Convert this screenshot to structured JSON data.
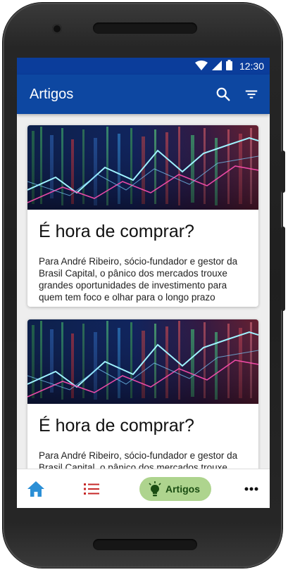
{
  "status_bar": {
    "time": "12:30"
  },
  "app_bar": {
    "title": "Artigos"
  },
  "articles": [
    {
      "title": "É hora de comprar?",
      "summary": "Para André Ribeiro, sócio-fundador e gestor da Brasil Capital, o pânico dos mercados trouxe grandes oportunidades de investimento para quem tem foco e olhar para o longo prazo"
    },
    {
      "title": "É hora de comprar?",
      "summary": "Para André Ribeiro, sócio-fundador e gestor da Brasil Capital, o pânico dos mercados trouxe grandes oportunidades de investimento para quem tem foco e olhar para o longo prazo"
    }
  ],
  "bottom_nav": {
    "active_label": "Artigos",
    "items": [
      "home-icon",
      "list-icon",
      "lightbulb-icon",
      "more-icon"
    ]
  },
  "colors": {
    "app_bar": "#0d47a1",
    "status_bar": "#0b3d9b",
    "active_pill": "#aed48e",
    "home_icon": "#2b8fd6",
    "list_icon": "#c62828"
  }
}
